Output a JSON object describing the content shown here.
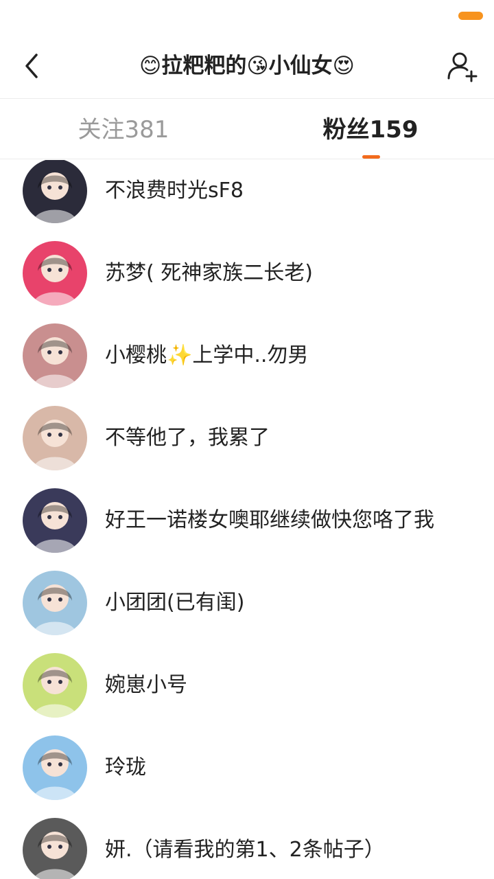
{
  "header": {
    "title": "😊拉粑粑的😘小仙女😍",
    "back_icon": "back-chevron-icon",
    "add_icon": "add-user-icon"
  },
  "tabs": {
    "following_label": "关注381",
    "fans_label": "粉丝159",
    "active_color": "#f26b1d"
  },
  "fans": [
    {
      "name": "不浪费时光sF8",
      "avatar_color": "#2b2b3a"
    },
    {
      "name": "苏梦( 死神家族二长老)",
      "avatar_color": "#e8436b"
    },
    {
      "name": "小樱桃✨上学中..勿男",
      "avatar_color": "#c98f8f"
    },
    {
      "name": "不等他了，我累了",
      "avatar_color": "#d8b8a8"
    },
    {
      "name": "好王一诺楼女噢耶继续做快您咯了我",
      "avatar_color": "#3a3a5a"
    },
    {
      "name": "小团团(已有闺)",
      "avatar_color": "#9fc6e0"
    },
    {
      "name": "婉崽小号",
      "avatar_color": "#c9e07a"
    },
    {
      "name": "玲珑",
      "avatar_color": "#8ec3ea"
    },
    {
      "name": "妍.（请看我的第1、2条帖子）",
      "avatar_color": "#5a5a5a"
    }
  ]
}
